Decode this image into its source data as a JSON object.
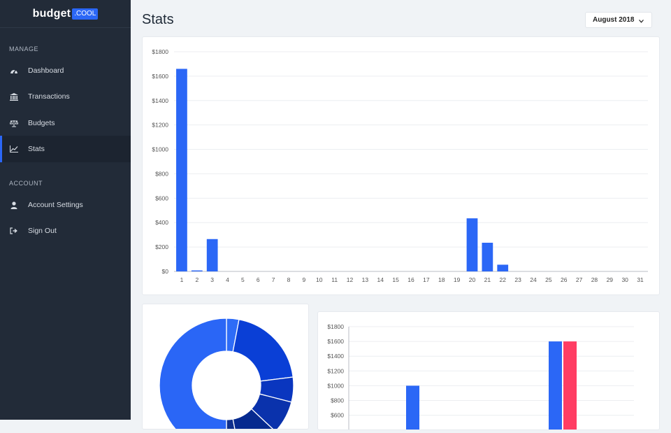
{
  "brand": {
    "word": "budget",
    "badge": ".COOL"
  },
  "sidebar": {
    "manage_label": "MANAGE",
    "account_label": "ACCOUNT",
    "items": [
      {
        "label": "Dashboard",
        "icon": "dashboard-icon"
      },
      {
        "label": "Transactions",
        "icon": "bank-icon"
      },
      {
        "label": "Budgets",
        "icon": "scale-icon"
      },
      {
        "label": "Stats",
        "icon": "line-chart-icon",
        "active": true
      },
      {
        "label": "Account Settings",
        "icon": "user-icon"
      },
      {
        "label": "Sign Out",
        "icon": "sign-out-icon"
      }
    ]
  },
  "header": {
    "title": "Stats",
    "month": "August 2018"
  },
  "colors": {
    "accent": "#2b67f6",
    "sidebar_bg": "#222b38",
    "bar_blue": "#2b67f6",
    "bar_red": "#ff3d63"
  },
  "chart_data": [
    {
      "type": "bar",
      "categories": [
        "1",
        "2",
        "3",
        "4",
        "5",
        "6",
        "7",
        "8",
        "9",
        "10",
        "11",
        "12",
        "13",
        "14",
        "15",
        "16",
        "17",
        "18",
        "19",
        "20",
        "21",
        "22",
        "23",
        "24",
        "25",
        "26",
        "27",
        "28",
        "29",
        "30",
        "31"
      ],
      "values": [
        1660,
        8,
        265,
        0,
        0,
        0,
        0,
        0,
        0,
        0,
        0,
        0,
        0,
        0,
        0,
        0,
        0,
        0,
        0,
        435,
        235,
        55,
        0,
        0,
        0,
        0,
        0,
        0,
        0,
        0,
        0
      ],
      "yticks": [
        "$0",
        "$200",
        "$400",
        "$600",
        "$800",
        "$1000",
        "$1200",
        "$1400",
        "$1600",
        "$1800"
      ],
      "ylim": [
        0,
        1800
      ],
      "grid": true
    },
    {
      "type": "pie",
      "values": [
        3,
        20,
        6,
        8,
        10,
        3,
        50
      ],
      "colors": [
        "#2e6cf7",
        "#0a3fd6",
        "#0a36bf",
        "#0a32ac",
        "#062a8f",
        "#0e2f8c",
        "#2a66f6"
      ]
    },
    {
      "type": "bar",
      "series": [
        {
          "values": [
            1000,
            1600
          ],
          "color": "#2b67f6"
        },
        {
          "values": [
            null,
            1600
          ],
          "color": "#ff3d63"
        }
      ],
      "yticks": [
        "$600",
        "$800",
        "$1000",
        "$1200",
        "$1400",
        "$1600",
        "$1800"
      ],
      "ylim": [
        0,
        1800
      ],
      "grid": true
    }
  ]
}
